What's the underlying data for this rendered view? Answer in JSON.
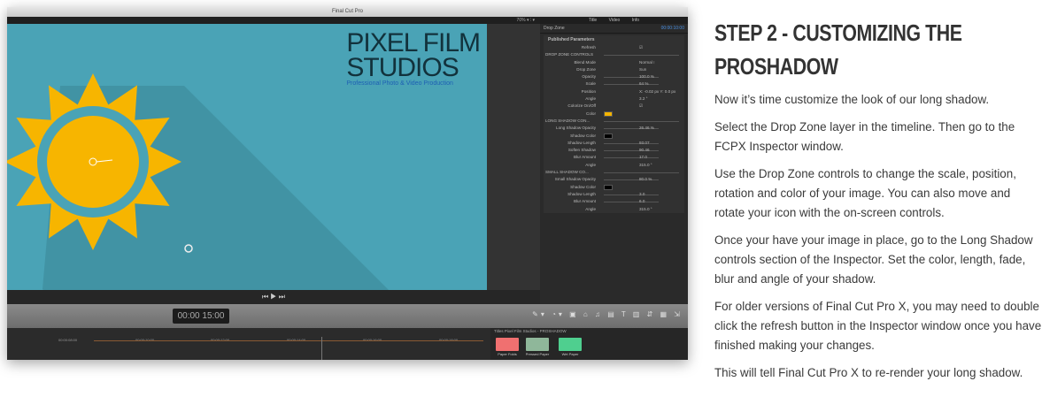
{
  "window": {
    "title": "Final Cut Pro",
    "zoom": "70% ▾  ⫶ ▾"
  },
  "viewer": {
    "logo_line1": "PIXEL FILM",
    "logo_line2": "STUDIOS",
    "logo_line3": "Professional Photo & Video Production",
    "transport": "⏮ ▶ ⏭"
  },
  "inspector": {
    "tabs": [
      "Title",
      "Video",
      "Info"
    ],
    "clip_name": "Drop Zone",
    "clip_timecode": "00:00:10:00",
    "section": "Published Parameters",
    "rows": [
      {
        "label": "Refresh",
        "value": "☑"
      },
      {
        "label": "DROP ZONE CONTROLS",
        "section": true
      },
      {
        "label": "Blend Mode",
        "value": "Normal ⁝"
      },
      {
        "label": "Drop Zone",
        "value": "Sun"
      },
      {
        "label": "Opacity",
        "value": "100.0 %",
        "slider": true
      },
      {
        "label": "Scale",
        "value": "64 %",
        "slider": true
      },
      {
        "label": "Position",
        "value": "X: -0.02 px  Y: 0.0 px"
      },
      {
        "label": "Angle",
        "value": "3.2 °"
      },
      {
        "label": "Colorize On/Off",
        "value": "☑"
      },
      {
        "label": "Color",
        "swatch": "#f4b400"
      },
      {
        "label": "LONG SHADOW CON...",
        "section": true
      },
      {
        "label": "Long Shadow Opacity",
        "value": "26.46 %",
        "slider": true
      },
      {
        "label": "Shadow Color",
        "swatch": "#000000"
      },
      {
        "label": "Shadow Length",
        "value": "93.07",
        "slider": true
      },
      {
        "label": "Soften Shadow",
        "value": "90.46",
        "slider": true
      },
      {
        "label": "Blur Amount",
        "value": "17.0",
        "slider": true
      },
      {
        "label": "Angle",
        "value": "315.0 °"
      },
      {
        "label": "SMALL SHADOW CO...",
        "section": true
      },
      {
        "label": "Small Shadow Opacity",
        "value": "80.0 %",
        "slider": true
      },
      {
        "label": "Shadow Color",
        "swatch": "#000000"
      },
      {
        "label": "Shadow Length",
        "value": "3.0",
        "slider": true
      },
      {
        "label": "Blur Amount",
        "value": "6.0",
        "slider": true
      },
      {
        "label": "Angle",
        "value": "315.0 °"
      }
    ]
  },
  "toolbar": {
    "timecode": "00:00 15:00",
    "tools": "✎▾ ◔▾ ▣ ⌂ ♫ ▤ T ▥ ⇵ ▦ ⇲"
  },
  "timeline": {
    "ruler": [
      "00:00:08:00",
      "00:00:10:00",
      "00:00:12:00",
      "00:00:14:00",
      "00:00:16:00",
      "00:00:18:00"
    ]
  },
  "browser": {
    "header": "Titles  Pixel Film Studios - PROSHADOW",
    "items": [
      {
        "label": "Paper Folds",
        "color": "#f07070"
      },
      {
        "label": "Pressed Paper",
        "color": "#8fb79a"
      },
      {
        "label": "Wet Paper",
        "color": "#4fcf8f"
      }
    ]
  },
  "article": {
    "heading": "STEP 2 - CUSTOMIZING THE PROSHADOW",
    "paragraphs": [
      "Now it’s time customize the look of our long shadow.",
      "Select the Drop Zone layer in the timeline. Then go to the FCPX Inspector window.",
      "Use the Drop Zone controls to change the scale, position, rotation and color of your image. You can also move and rotate your icon with the on-screen controls.",
      "Once your have your image in place, go to the Long Shadow controls section of the Inspector. Set the color, length, fade, blur and angle of your shadow.",
      "For older versions of Final Cut Pro X, you may need to double click the refresh button in the Inspector window once you have finished making your changes.",
      "This will tell Final Cut Pro X to re-render your long shadow."
    ]
  }
}
